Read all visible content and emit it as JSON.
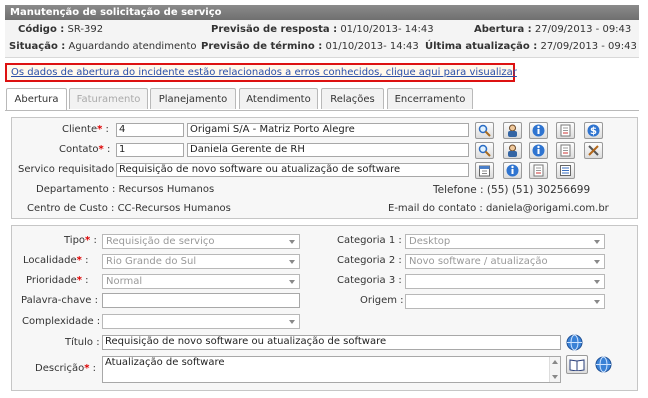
{
  "window_title": "Manutenção de solicitação de serviço",
  "header": {
    "codigo_label": "Código :",
    "codigo_value": "SR-392",
    "situacao_label": "Situação :",
    "situacao_value": "Aguardando atendimento",
    "prev_resposta_label": "Previsão de resposta :",
    "prev_resposta_value": "01/10/2013- 14:43",
    "prev_termino_label": "Previsão de término :",
    "prev_termino_value": "01/10/2013- 14:43",
    "abertura_label": "Abertura :",
    "abertura_value": "27/09/2013 - 09:43",
    "ultima_label": "Última atualização :",
    "ultima_value": "27/09/2013 - 09:43"
  },
  "alert_link": "Os dados de abertura do incidente estão relacionados a erros conhecidos, clique aqui para visualizar",
  "tabs": [
    {
      "label": "Abertura",
      "state": "active"
    },
    {
      "label": "Faturamento",
      "state": "disabled"
    },
    {
      "label": "Planejamento",
      "state": "normal"
    },
    {
      "label": "Atendimento",
      "state": "normal"
    },
    {
      "label": "Relações",
      "state": "normal"
    },
    {
      "label": "Encerramento",
      "state": "normal"
    }
  ],
  "client": {
    "cliente_label": "Cliente",
    "cliente_id": "4",
    "cliente_name": "Origami S/A - Matriz Porto Alegre",
    "contato_label": "Contato",
    "contato_id": "1",
    "contato_name": "Daniela Gerente de RH",
    "servico_label": "Servico requisitado :",
    "servico_value": "Requisição de novo software ou atualização de software",
    "departamento_label": "Departamento :",
    "departamento_value": "Recursos Humanos",
    "centro_label": "Centro de Custo :",
    "centro_value": "CC-Recursos Humanos",
    "telefone_label": "Telefone :",
    "telefone_value": "(55) (51) 30256699",
    "email_label": "E-mail do contato :",
    "email_value": "daniela@origami.com.br"
  },
  "details": {
    "tipo_label": "Tipo",
    "tipo_value": "Requisição de serviço",
    "localidade_label": "Localidade",
    "localidade_value": "Rio Grande do Sul",
    "prioridade_label": "Prioridade",
    "prioridade_value": "Normal",
    "palavra_label": "Palavra-chave :",
    "palavra_value": "",
    "complexidade_label": "Complexidade :",
    "complexidade_value": "",
    "cat1_label": "Categoria 1 :",
    "cat1_value": "Desktop",
    "cat2_label": "Categoria 2 :",
    "cat2_value": "Novo software / atualização",
    "cat3_label": "Categoria 3 :",
    "cat3_value": "",
    "origem_label": "Origem :",
    "origem_value": "",
    "titulo_label": "Título :",
    "titulo_value": "Requisição de novo software ou atualização de software",
    "descricao_label": "Descrição",
    "descricao_value": "Atualização de software"
  },
  "colors": {
    "titlebar": "#7a7a7a",
    "alert_border": "#dd1111",
    "link": "#2a4fa8",
    "required": "#dd0000"
  }
}
